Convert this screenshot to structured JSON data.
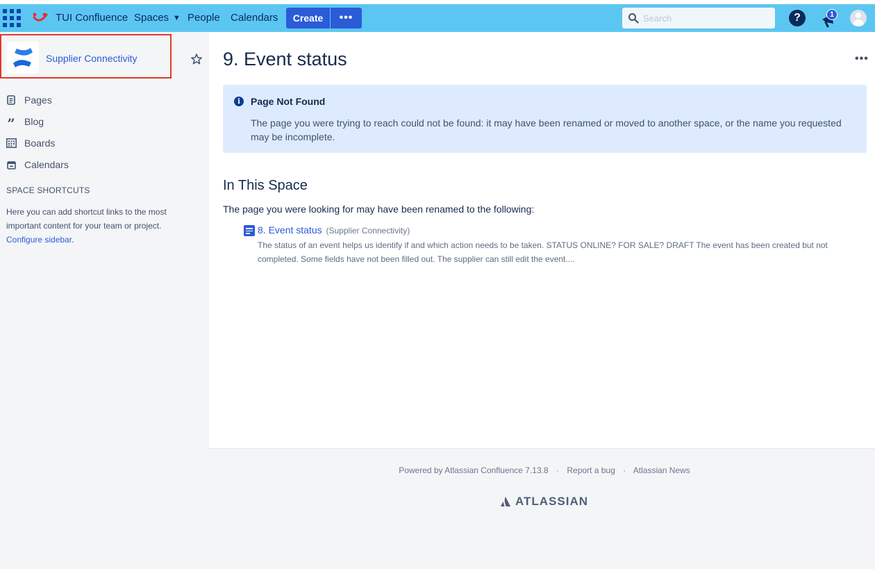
{
  "header": {
    "brand": "TUI Confluence",
    "nav": {
      "spaces": "Spaces",
      "people": "People",
      "calendars": "Calendars"
    },
    "create_label": "Create",
    "more_label": "•••",
    "search_placeholder": "Search",
    "help_label": "?",
    "notification_count": "1",
    "colors": {
      "bar": "#5cc6f2",
      "button": "#2b5bd7",
      "tui_logo": "#e32f2f"
    }
  },
  "sidebar": {
    "space_name": "Supplier Connectivity",
    "items": [
      {
        "label": "Pages",
        "icon": "page-icon"
      },
      {
        "label": "Blog",
        "icon": "quote-icon"
      },
      {
        "label": "Boards",
        "icon": "calendar-grid-icon"
      },
      {
        "label": "Calendars",
        "icon": "calendar-icon"
      }
    ],
    "shortcuts_title": "SPACE SHORTCUTS",
    "shortcuts_text": "Here you can add shortcut links to the most important content for your team or project.",
    "configure_link": "Configure sidebar",
    "configure_suffix": "."
  },
  "main": {
    "page_title": "9. Event status",
    "actions_label": "•••",
    "info": {
      "title": "Page Not Found",
      "body": "The page you were trying to reach could not be found: it may have been renamed or moved to another space, or the name you requested may be incomplete."
    },
    "section_title": "In This Space",
    "section_desc": "The page you were looking for may have been renamed to the following:",
    "result": {
      "title": "8. Event status",
      "space": "(Supplier Connectivity)",
      "excerpt": "The status of an event helps us identify if and which action needs to be taken. STATUS ONLINE? FOR SALE?  DRAFT The event has been created but not completed. Some fields have not been filled out. The supplier can still edit the event...."
    }
  },
  "footer": {
    "powered_by": "Powered by Atlassian Confluence 7.13.8",
    "separator": "·",
    "report_bug": "Report a bug",
    "news": "Atlassian News",
    "logo_text": "ATLASSIAN"
  }
}
